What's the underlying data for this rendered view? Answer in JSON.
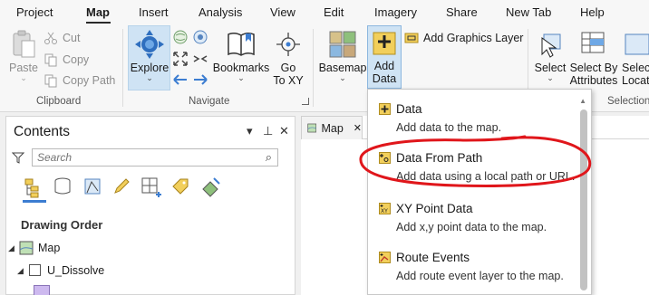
{
  "menu": {
    "tabs": [
      "Project",
      "Map",
      "Insert",
      "Analysis",
      "View",
      "Edit",
      "Imagery",
      "Share",
      "New Tab",
      "Help"
    ],
    "active": "Map"
  },
  "ribbon": {
    "clipboard": {
      "paste": "Paste",
      "cut": "Cut",
      "copy": "Copy",
      "copy_path": "Copy Path",
      "group_label": "Clipboard"
    },
    "navigate": {
      "explore": "Explore",
      "bookmarks": "Bookmarks",
      "goto": "Go",
      "goto2": "To XY",
      "group_label": "Navigate"
    },
    "layer": {
      "basemap": "Basemap",
      "add_data": "Add",
      "add_data2": "Data",
      "add_graphics_layer": "Add Graphics Layer"
    },
    "selection": {
      "select": "Select",
      "select_by": "Select By",
      "select_by2": "Attributes",
      "select_loc": "Select",
      "select_loc2": "Locat",
      "group_label": "Selection"
    }
  },
  "contents": {
    "title": "Contents",
    "search_placeholder": "Search",
    "drawing_order": "Drawing Order",
    "tree": {
      "map": "Map",
      "layer": "U_Dissolve"
    }
  },
  "map_tab": {
    "label": "Map"
  },
  "add_data_menu": [
    {
      "title": "Data",
      "desc": "Add data to the map."
    },
    {
      "title": "Data From Path",
      "desc": "Add data using a local path or URL."
    },
    {
      "title": "XY Point Data",
      "desc": "Add x,y point data to the map."
    },
    {
      "title": "Route Events",
      "desc": "Add route event layer to the map."
    }
  ],
  "colors": {
    "accent": "#cfe3f4",
    "annotation": "#e0161b",
    "layer_swatch": "#cdb9ef"
  }
}
